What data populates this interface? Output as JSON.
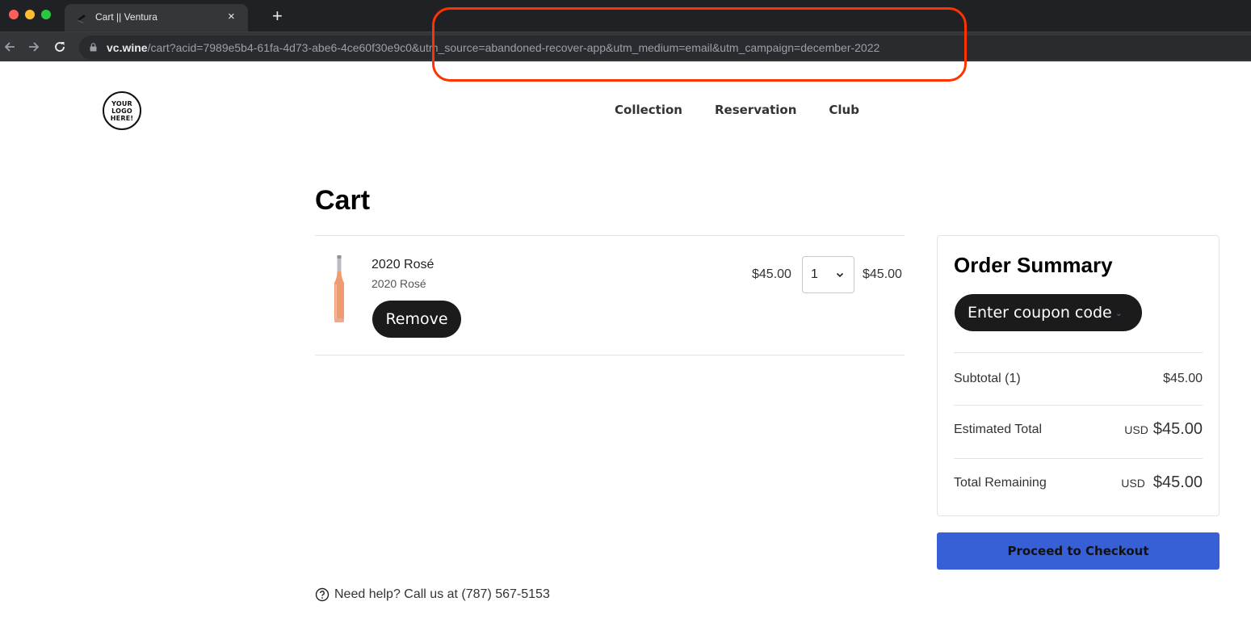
{
  "browser": {
    "tab_title": "Cart || Ventura",
    "new_tab_label": "+",
    "close_label": "×",
    "url_host": "vc.wine",
    "url_path": "/cart?acid=7989e5b4-61fa-4d73-abe6-4ce60f30e9c0&utm_source=abandoned-recover-app&utm_medium=email&utm_campaign=december-2022",
    "back_icon": "arrow-left-icon",
    "forward_icon": "arrow-right-icon",
    "reload_icon": "reload-icon"
  },
  "annotation": {
    "color": "#ff3300",
    "highlights": "utm parameters in URL"
  },
  "header": {
    "logo_lines": [
      "YOUR",
      "LOGO",
      "HERE!"
    ],
    "nav": [
      {
        "label": "Collection"
      },
      {
        "label": "Reservation"
      },
      {
        "label": "Club"
      }
    ]
  },
  "cart": {
    "title": "Cart",
    "items": [
      {
        "name": "2020 Rosé",
        "subtitle": "2020 Rosé",
        "unit_price": "$45.00",
        "quantity": "1",
        "line_total": "$45.00",
        "remove_label": "Remove"
      }
    ]
  },
  "summary": {
    "title": "Order Summary",
    "coupon_label": "Enter coupon code",
    "rows": [
      {
        "label": "Subtotal (1)",
        "currency": "",
        "value": "$45.00"
      },
      {
        "label": "Estimated Total",
        "currency": "USD",
        "value": "$45.00"
      },
      {
        "label": "Total Remaining",
        "currency": "USD",
        "value": "$45.00"
      }
    ],
    "checkout_label": "Proceed to Checkout",
    "checkout_color": "#375fd6"
  },
  "help": {
    "text": "Need help? Call us at (787) 567-5153",
    "icon": "question-circle-icon"
  }
}
